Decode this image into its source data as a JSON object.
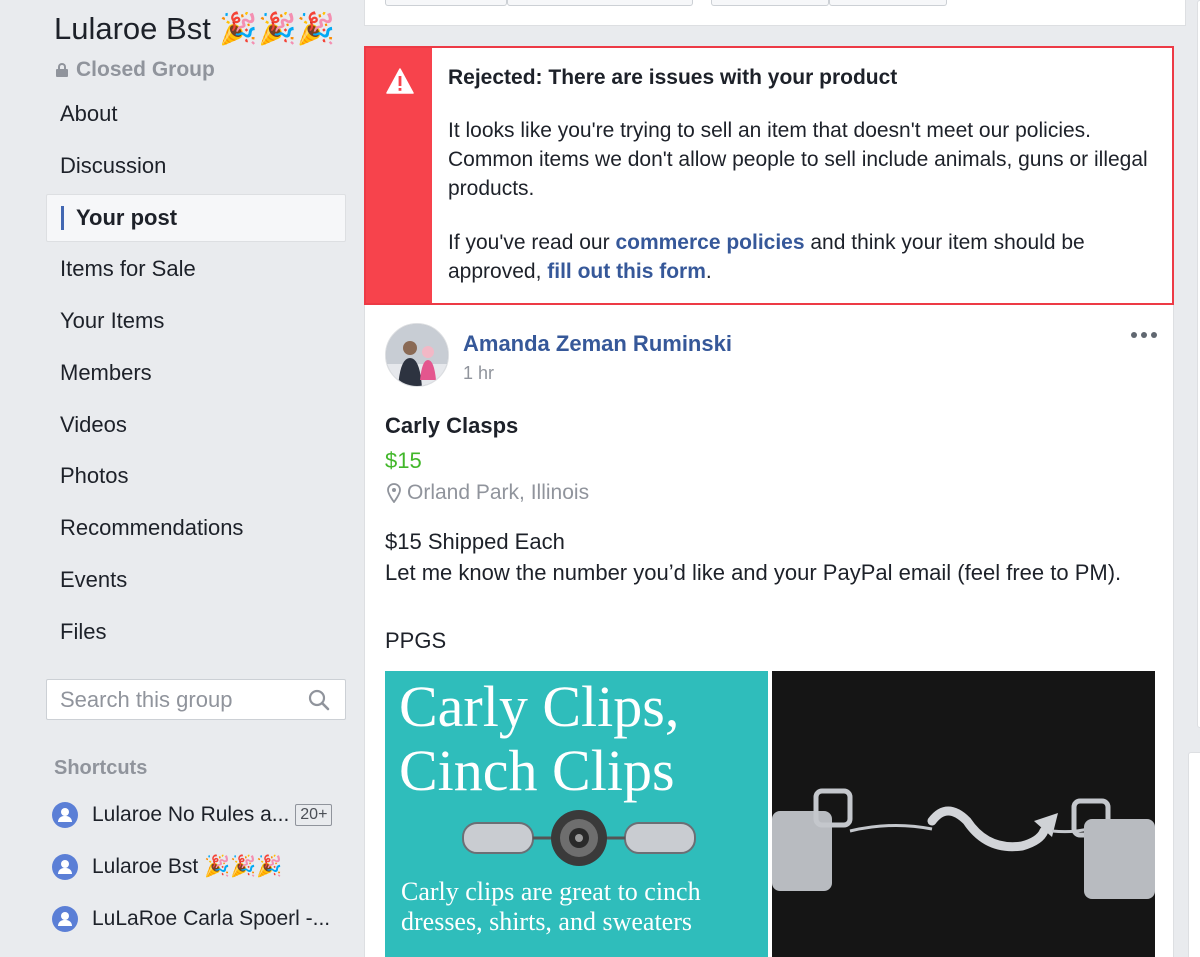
{
  "group": {
    "name": "Lularoe Bst 🎉🎉🎉",
    "privacy": "Closed Group"
  },
  "nav": {
    "items": [
      {
        "label": "About"
      },
      {
        "label": "Discussion"
      },
      {
        "label": "Your post",
        "active": true
      },
      {
        "label": "Items for Sale"
      },
      {
        "label": "Your Items"
      },
      {
        "label": "Members"
      },
      {
        "label": "Videos"
      },
      {
        "label": "Photos"
      },
      {
        "label": "Recommendations"
      },
      {
        "label": "Events"
      },
      {
        "label": "Files"
      }
    ]
  },
  "search": {
    "placeholder": "Search this group",
    "icon": "search-icon"
  },
  "shortcuts": {
    "label": "Shortcuts",
    "items": [
      {
        "label": "Lularoe No Rules a...",
        "badge": "20+"
      },
      {
        "label": "Lularoe Bst 🎉🎉🎉"
      },
      {
        "label": "LuLaRoe Carla Spoerl -..."
      }
    ]
  },
  "alert": {
    "title": "Rejected: There are issues with your product",
    "text": "It looks like you're trying to sell an item that doesn't meet our policies. Common items we don't allow people to sell include animals, guns or illegal products.",
    "text2_a": "If you've read our ",
    "link1": "commerce policies",
    "text2_b": " and think your item should be approved, ",
    "link2": "fill out this form",
    "text2_c": ".",
    "colors": {
      "side": "#f7434c",
      "border": "#ed3a45"
    }
  },
  "post": {
    "author": "Amanda Zeman Ruminski",
    "time": "1 hr",
    "title": "Carly Clasps",
    "price": "$15",
    "location": "Orland Park, Illinois",
    "description_line1": "$15 Shipped Each",
    "description_line2": "Let me know the number you’d like and your PayPal email (feel free to PM).",
    "description_line3": "PPGS",
    "photo1": {
      "heading_line1": "Carly Clips,",
      "heading_line2": "Cinch Clips",
      "caption_line1": "Carly clips are great to cinch",
      "caption_line2": "dresses, shirts, and sweaters"
    }
  },
  "colors": {
    "link": "#365899",
    "price": "#42b72a",
    "accent": "#4267b2"
  }
}
